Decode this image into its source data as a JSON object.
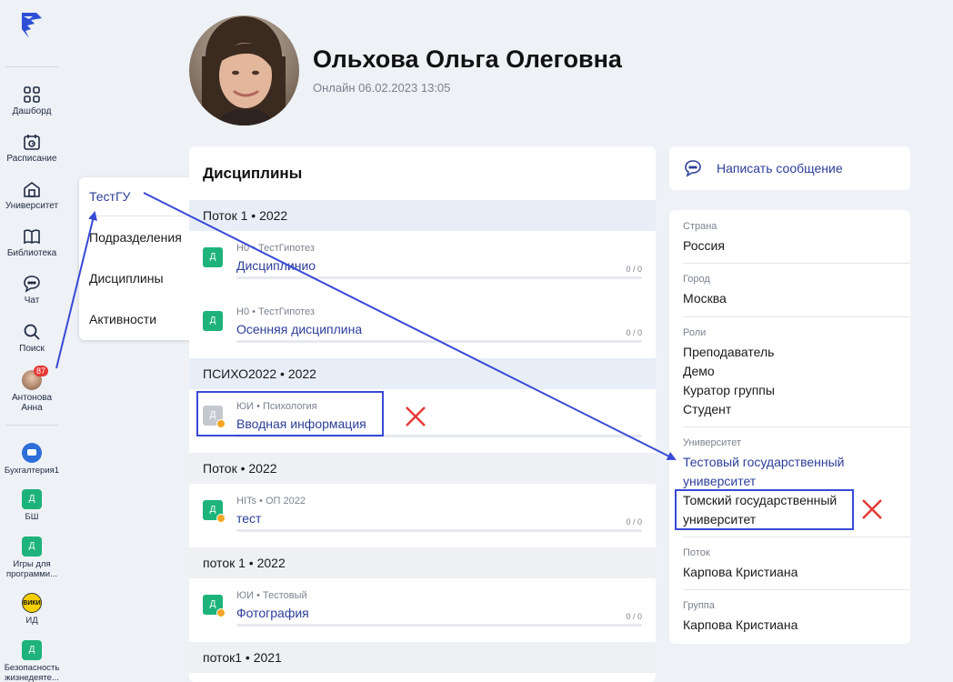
{
  "sidebar": {
    "nav": [
      {
        "label": "Дашборд",
        "icon": "dashboard-icon"
      },
      {
        "label": "Расписание",
        "icon": "calendar-icon"
      },
      {
        "label": "Университет",
        "icon": "university-icon"
      },
      {
        "label": "Библиотека",
        "icon": "book-icon"
      },
      {
        "label": "Чат",
        "icon": "chat-icon"
      },
      {
        "label": "Поиск",
        "icon": "search-icon"
      }
    ],
    "user": {
      "name_line1": "Антонова",
      "name_line2": "Анна",
      "badge": "87"
    },
    "apps": [
      {
        "label": "Бухгалтерия1",
        "tile": ""
      },
      {
        "label": "БШ",
        "tile": "Д"
      },
      {
        "label_line1": "Игры для",
        "label_line2": "программи...",
        "tile": "Д"
      },
      {
        "label": "ИД",
        "tile": "ВИКИ"
      },
      {
        "label_line1": "Безопасность",
        "label_line2": "жизнедеяте...",
        "tile": "Д"
      }
    ]
  },
  "popup": {
    "items": [
      "ТестГУ",
      "Подразделения",
      "Дисциплины",
      "Активности"
    ]
  },
  "profile": {
    "name": "Ольхова Ольга Олеговна",
    "status": "Онлайн 06.02.2023 13:05"
  },
  "disciplines": {
    "title": "Дисциплины",
    "groups": [
      {
        "header": "Поток 1 • 2022"
      },
      {
        "header": "ПСИХО2022 • 2022"
      },
      {
        "header": "Поток • 2022"
      },
      {
        "header": "поток 1 • 2022"
      },
      {
        "header": "поток1 • 2021"
      }
    ],
    "entries": [
      {
        "tile": "Д",
        "meta": "Н0 • ТестГипотез",
        "name": "Дисциплинио",
        "score": "0 / 0"
      },
      {
        "tile": "Д",
        "meta": "Н0 • ТестГипотез",
        "name": "Осенняя дисциплина",
        "score": "0 / 0"
      },
      {
        "tile": "Д",
        "meta": "ЮИ • Психология",
        "name": "Вводная информация",
        "score": ""
      },
      {
        "tile": "Д",
        "meta": "HITs • ОП 2022",
        "name": "тест",
        "score": "0 / 0"
      },
      {
        "tile": "Д",
        "meta": "ЮИ • Тестовый",
        "name": "Фотография",
        "score": "0 / 0"
      }
    ]
  },
  "message_button": {
    "label": "Написать сообщение"
  },
  "info": {
    "country": {
      "label": "Страна",
      "value": "Россия"
    },
    "city": {
      "label": "Город",
      "value": "Москва"
    },
    "roles": {
      "label": "Роли",
      "values": [
        "Преподаватель",
        "Демо",
        "Куратор группы",
        "Студент"
      ]
    },
    "university": {
      "label": "Университет",
      "link_line1": "Тестовый государственный",
      "link_line2": "университет",
      "other_line1": "Томский государственный",
      "other_line2": "университет"
    },
    "stream": {
      "label": "Поток",
      "value": "Карпова Кристиана"
    },
    "group": {
      "label": "Группа",
      "value": "Карпова Кристиана"
    }
  },
  "colors": {
    "accent": "#2c3e99",
    "annotation": "#3849d6",
    "cross": "#e53935",
    "green_tile": "#1db37a"
  }
}
